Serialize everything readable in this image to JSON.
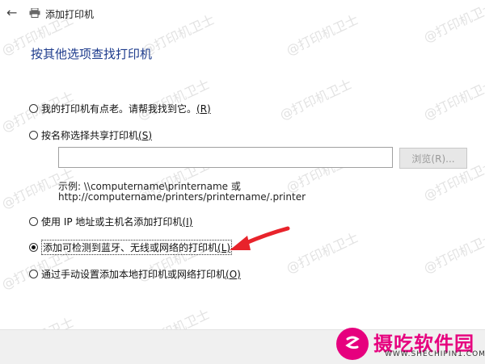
{
  "window": {
    "title": "添加打印机",
    "back_icon": "arrow-left-icon",
    "app_icon": "printer-icon"
  },
  "heading": "按其他选项查找打印机",
  "options": [
    {
      "label": "我的打印机有点老。请帮我找到它。",
      "key": "(R)",
      "checked": false
    },
    {
      "label": "按名称选择共享打印机",
      "key": "(S)",
      "checked": false
    },
    {
      "label": "使用 IP 地址或主机名添加打印机",
      "key": "(I)",
      "checked": false
    },
    {
      "label": "添加可检测到蓝牙、无线或网络的打印机",
      "key": "(L)",
      "checked": true
    },
    {
      "label": "通过手动设置添加本地打印机或网络打印机",
      "key": "(O)",
      "checked": false
    }
  ],
  "share_input": {
    "value": "",
    "placeholder": ""
  },
  "browse_button": {
    "label": "浏览(R)..."
  },
  "example": {
    "line1": "示例: \\\\computername\\printername 或",
    "line2": "http://computername/printers/printername/.printer"
  },
  "watermark": "@打印机卫士",
  "logo": {
    "name": "摄吃软件园",
    "url": "WWW.SHECHIPIN1.COM"
  },
  "colors": {
    "heading": "#1d3b8c",
    "arrow": "#e8232b",
    "logo": "#e6007e"
  }
}
